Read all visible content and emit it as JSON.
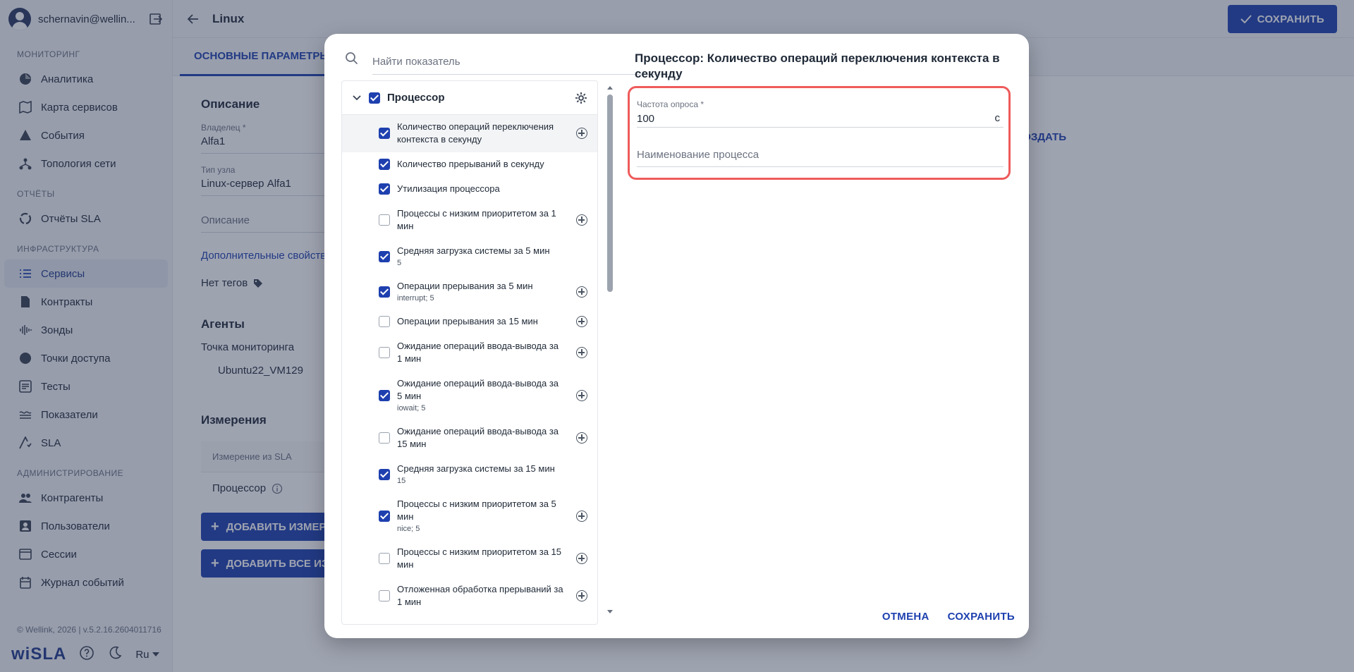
{
  "user": {
    "name": "schernavin@wellin..."
  },
  "sidebar": {
    "sections": [
      {
        "title": "МОНИТОРИНГ",
        "items": [
          "Аналитика",
          "Карта сервисов",
          "События",
          "Топология сети"
        ]
      },
      {
        "title": "ОТЧЁТЫ",
        "items": [
          "Отчёты SLA"
        ]
      },
      {
        "title": "ИНФРАСТРУКТУРА",
        "items": [
          "Сервисы",
          "Контракты",
          "Зонды",
          "Точки доступа",
          "Тесты",
          "Показатели",
          "SLA"
        ]
      },
      {
        "title": "АДМИНИСТРИРОВАНИЕ",
        "items": [
          "Контрагенты",
          "Пользователи",
          "Сессии",
          "Журнал событий"
        ]
      }
    ],
    "copyright": "© Wellink, 2026 | v.5.2.16.2604011716",
    "brand": "wiSLA",
    "language": "Ru"
  },
  "header": {
    "title": "Linux",
    "save_label": "СОХРАНИТЬ"
  },
  "tabs": {
    "active": "ОСНОВНЫЕ ПАРАМЕТРЫ"
  },
  "main": {
    "description_heading": "Описание",
    "owner_label": "Владелец *",
    "owner_value": "Alfa1",
    "node_type_label": "Тип узла",
    "node_type_value": "Linux-сервер Alfa1",
    "description_placeholder": "Описание",
    "extra_props_link": "Дополнительные свойства",
    "no_tags": "Нет тегов",
    "agents_heading": "Агенты",
    "monitoring_point_label": "Точка мониторинга",
    "monitoring_point_value": "Ubuntu22_VM129",
    "measurements_heading": "Измерения",
    "measurement_col": "Измерение из SLA",
    "measurement_row": "Процессор",
    "add_measure_btn": "ДОБАВИТЬ ИЗМЕРЕ",
    "add_all_btn": "ДОБАВИТЬ ВСЕ ИЗ",
    "create_link": "СОЗДАТЬ"
  },
  "modal": {
    "search_placeholder": "Найти показатель",
    "group_label": "Процессор",
    "items": [
      {
        "label": "Количество операций переключения контекста в секунду",
        "sub": "",
        "checked": true,
        "plus": true,
        "selected": true
      },
      {
        "label": "Количество прерываний в секунду",
        "sub": "",
        "checked": true,
        "plus": false
      },
      {
        "label": "Утилизация процессора",
        "sub": "",
        "checked": true,
        "plus": false
      },
      {
        "label": "Процессы с низким приоритетом за 1 мин",
        "sub": "",
        "checked": false,
        "plus": true
      },
      {
        "label": "Средняя загрузка системы за 5 мин",
        "sub": "5",
        "checked": true,
        "plus": false
      },
      {
        "label": "Операции прерывания за 5 мин",
        "sub": "interrupt; 5",
        "checked": true,
        "plus": true
      },
      {
        "label": "Операции прерывания за 15 мин",
        "sub": "",
        "checked": false,
        "plus": true
      },
      {
        "label": "Ожидание операций ввода-вывода за 1 мин",
        "sub": "",
        "checked": false,
        "plus": true
      },
      {
        "label": "Ожидание операций ввода-вывода за 5 мин",
        "sub": "iowait; 5",
        "checked": true,
        "plus": true
      },
      {
        "label": "Ожидание операций ввода-вывода за 15 мин",
        "sub": "",
        "checked": false,
        "plus": true
      },
      {
        "label": "Средняя загрузка системы за 15 мин",
        "sub": "15",
        "checked": true,
        "plus": false
      },
      {
        "label": "Процессы с низким приоритетом за 5 мин",
        "sub": "nice; 5",
        "checked": true,
        "plus": true
      },
      {
        "label": "Процессы с низким приоритетом за 15 мин",
        "sub": "",
        "checked": false,
        "plus": true
      },
      {
        "label": "Отложенная обработка прерываний за 1 мин",
        "sub": "",
        "checked": false,
        "plus": true
      }
    ],
    "detail_title": "Процессор: Количество операций переключения контекста в секунду",
    "poll_label": "Частота опроса *",
    "poll_value": "100",
    "poll_unit": "с",
    "process_placeholder": "Наименование процесса",
    "cancel_label": "ОТМЕНА",
    "save_label": "СОХРАНИТЬ"
  },
  "colors": {
    "accent": "#1e40af",
    "highlight": "#ef5b5b"
  }
}
